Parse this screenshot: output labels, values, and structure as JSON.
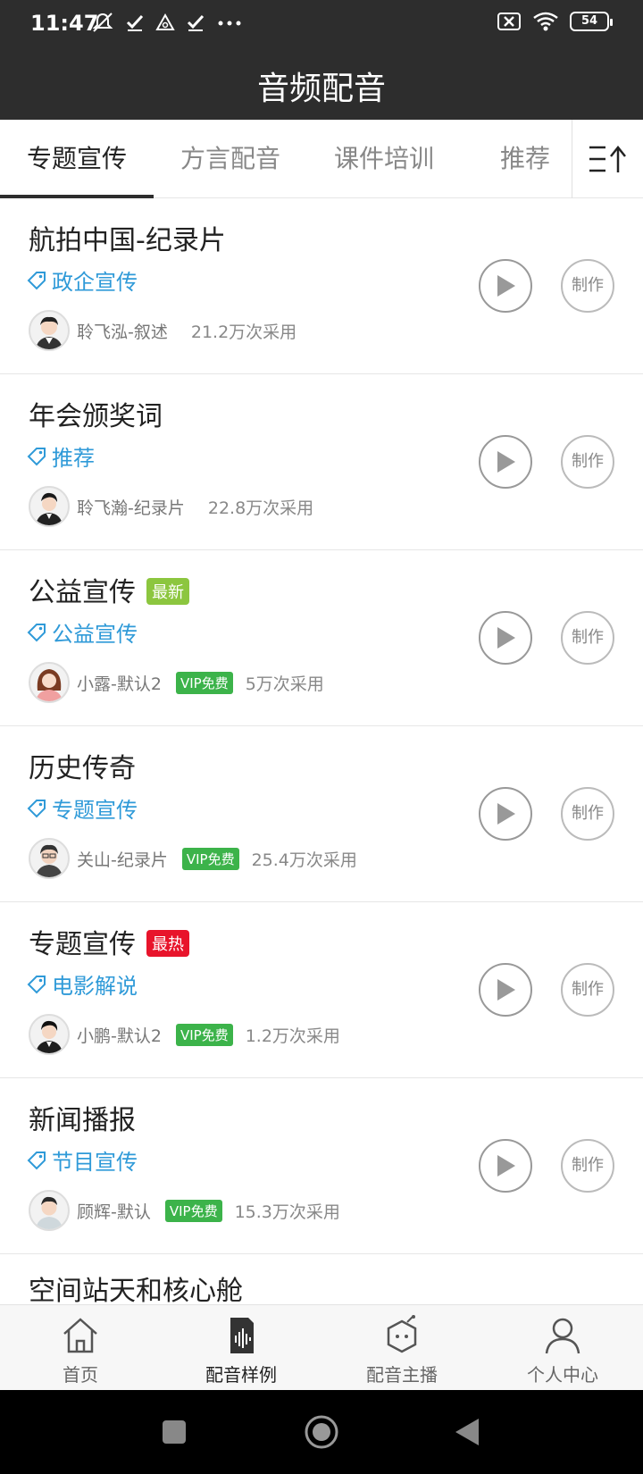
{
  "status_bar": {
    "time": "11:47",
    "battery": "54"
  },
  "header": {
    "title": "音频配音"
  },
  "tabs": [
    {
      "label": "专题宣传",
      "active": true
    },
    {
      "label": "方言配音",
      "active": false
    },
    {
      "label": "课件培训",
      "active": false
    },
    {
      "label": "推荐",
      "active": false
    }
  ],
  "items": [
    {
      "title": "航拍中国-纪录片",
      "badge": "",
      "tag": "政企宣传",
      "speaker": "聆飞泓-叙述",
      "vip": "",
      "usage": "21.2万次采用",
      "make_label": "制作"
    },
    {
      "title": "年会颁奖词",
      "badge": "",
      "tag": "推荐",
      "speaker": "聆飞瀚-纪录片",
      "vip": "",
      "usage": "22.8万次采用",
      "make_label": "制作"
    },
    {
      "title": "公益宣传",
      "badge": "最新",
      "tag": "公益宣传",
      "speaker": "小露-默认2",
      "vip": "VIP免费",
      "usage": "5万次采用",
      "make_label": "制作"
    },
    {
      "title": "历史传奇",
      "badge": "",
      "tag": "专题宣传",
      "speaker": "关山-纪录片",
      "vip": "VIP免费",
      "usage": "25.4万次采用",
      "make_label": "制作"
    },
    {
      "title": "专题宣传",
      "badge": "最热",
      "tag": "电影解说",
      "speaker": "小鹏-默认2",
      "vip": "VIP免费",
      "usage": "1.2万次采用",
      "make_label": "制作"
    },
    {
      "title": "新闻播报",
      "badge": "",
      "tag": "节目宣传",
      "speaker": "顾辉-默认",
      "vip": "VIP免费",
      "usage": "15.3万次采用",
      "make_label": "制作"
    }
  ],
  "peek_item": {
    "title": "空间站天和核心舱"
  },
  "bottom_nav": [
    {
      "label": "首页",
      "icon": "home-icon",
      "active": false
    },
    {
      "label": "配音样例",
      "icon": "audio-sample-icon",
      "active": true
    },
    {
      "label": "配音主播",
      "icon": "anchor-icon",
      "active": false
    },
    {
      "label": "个人中心",
      "icon": "person-icon",
      "active": false
    }
  ],
  "colors": {
    "header_bg": "#2d2d2d",
    "tag_blue": "#2f9ad8",
    "badge_new": "#8cc63f",
    "badge_hot": "#e8142b",
    "vip_green": "#3cb34a"
  }
}
